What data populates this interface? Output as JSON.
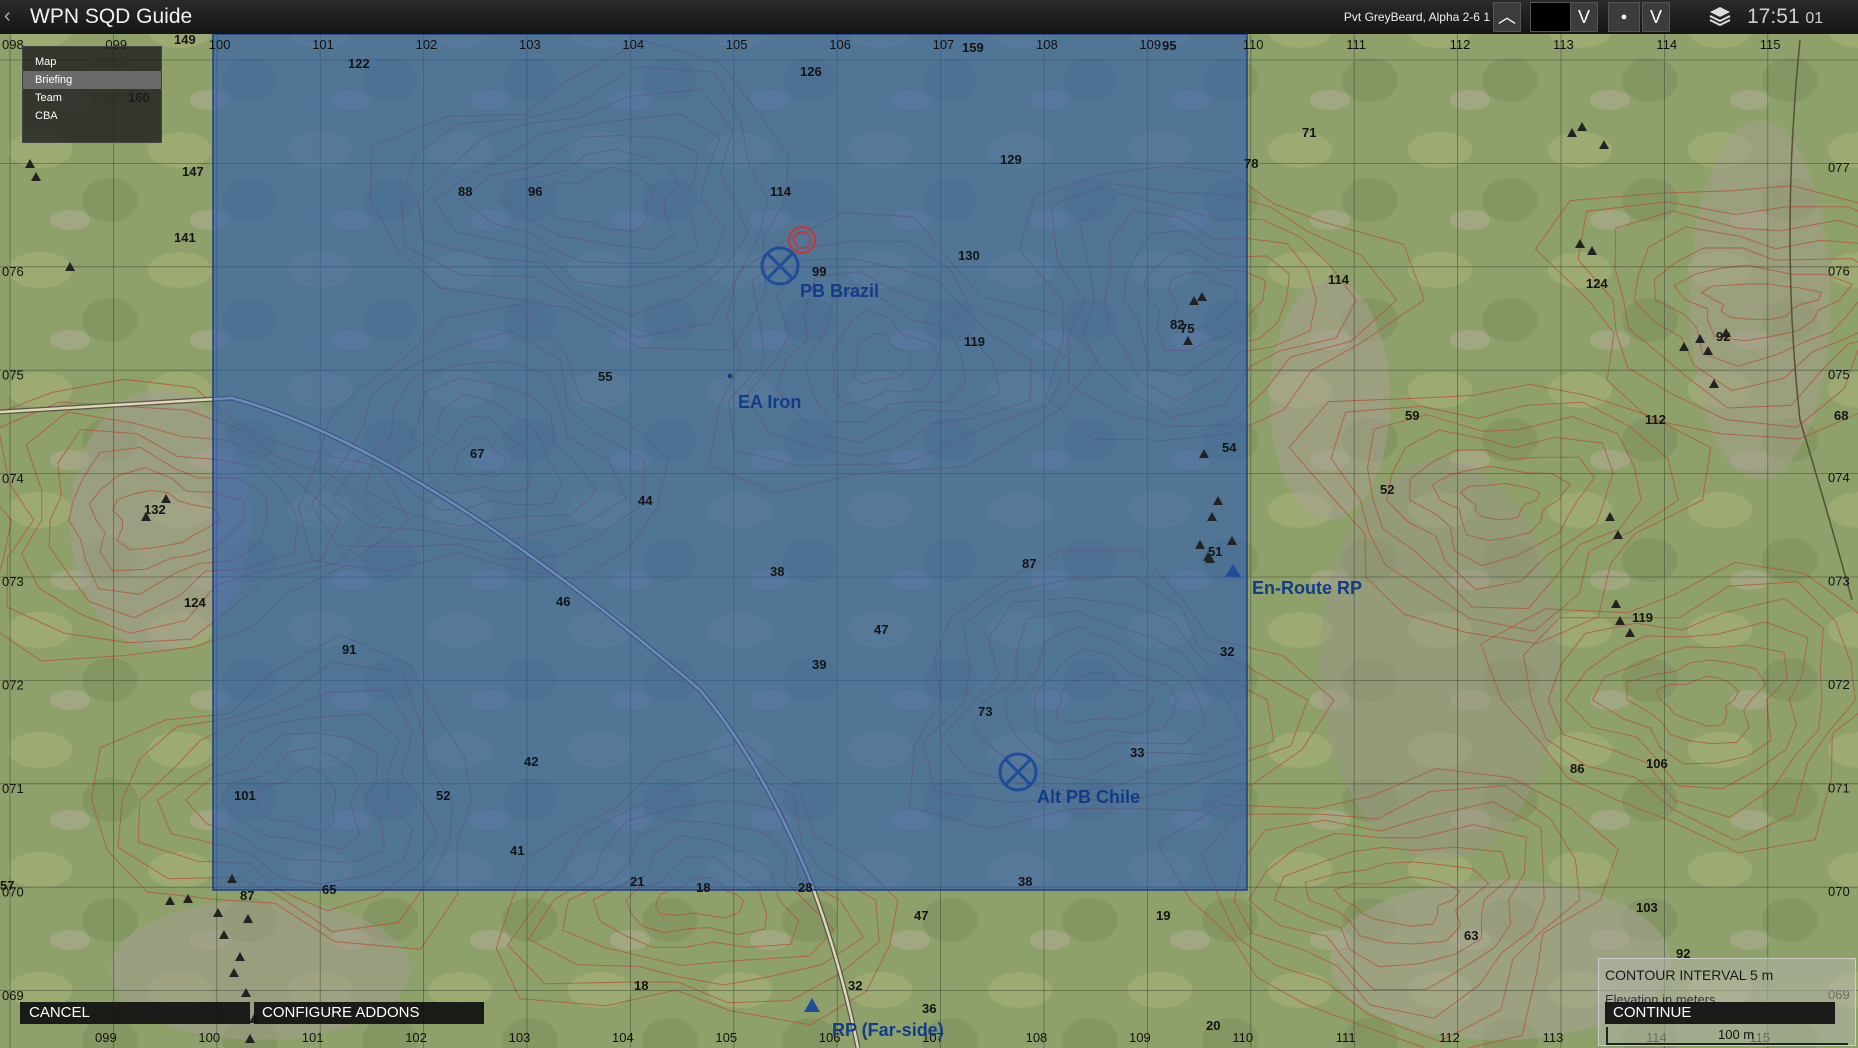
{
  "topbar": {
    "back": "‹",
    "title": "WPN SQD Guide",
    "player": "Pvt GreyBeard, Alpha 2-6 1",
    "chevron_up": "︿",
    "dropdown_a": "V",
    "dot": "●",
    "dropdown_b": "V",
    "layers_icon": "layers-icon",
    "clock_hm": "17:51",
    "clock_s": "01"
  },
  "menu": {
    "items": [
      "Map",
      "Briefing",
      "Team",
      "CBA"
    ],
    "active": "Briefing"
  },
  "map": {
    "colors": {
      "terrain": "#8fa16a",
      "zone": "#2f5fae",
      "contour": "#b0583f",
      "grid": "#3d4a3a",
      "road": "#d9d3b8",
      "marker": "#1f4d9a",
      "text": "#151515"
    },
    "grid_top": [
      "098",
      "099",
      "100",
      "101",
      "102",
      "103",
      "104",
      "105",
      "106",
      "107",
      "108",
      "109",
      "110",
      "111",
      "112",
      "113",
      "114",
      "115"
    ],
    "grid_bottom": [
      "099",
      "100",
      "101",
      "102",
      "103",
      "104",
      "105",
      "106",
      "107",
      "108",
      "109",
      "110",
      "111",
      "112",
      "113",
      "114",
      "115"
    ],
    "grid_left": [
      "076",
      "075",
      "074",
      "073",
      "072",
      "071",
      "070",
      "069"
    ],
    "grid_right": [
      "077",
      "076",
      "075",
      "074",
      "073",
      "072",
      "071",
      "070",
      "069"
    ],
    "markers": {
      "pb_brazil": "PB Brazil",
      "ea_iron": "EA  Iron",
      "alt_pb_chile": "Alt  PB  Chile",
      "enroute_rp": "En-Route  RP",
      "rp_farside": "RP  (Far-side)"
    },
    "elevations": [
      "149",
      "122",
      "126",
      "159",
      "95",
      "147",
      "160",
      "129",
      "88",
      "96",
      "114",
      "71",
      "78",
      "141",
      "130",
      "99",
      "114",
      "82",
      "124",
      "75",
      "119",
      "55",
      "92",
      "59",
      "112",
      "68",
      "67",
      "54",
      "52",
      "132",
      "44",
      "38",
      "87",
      "51",
      "124",
      "46",
      "47",
      "119",
      "91",
      "39",
      "32",
      "73",
      "33",
      "86",
      "106",
      "101",
      "52",
      "42",
      "41",
      "21",
      "18",
      "28",
      "38",
      "65",
      "87",
      "47",
      "19",
      "103",
      "63",
      "92",
      "18",
      "32",
      "36",
      "20",
      "57"
    ]
  },
  "buttons": {
    "cancel": "CANCEL",
    "configure": "CONFIGURE ADDONS",
    "continue": "CONTINUE"
  },
  "legend": {
    "contour_interval": "CONTOUR INTERVAL 5 m",
    "elevation": "Elevation in meters",
    "scale": "100 m"
  }
}
